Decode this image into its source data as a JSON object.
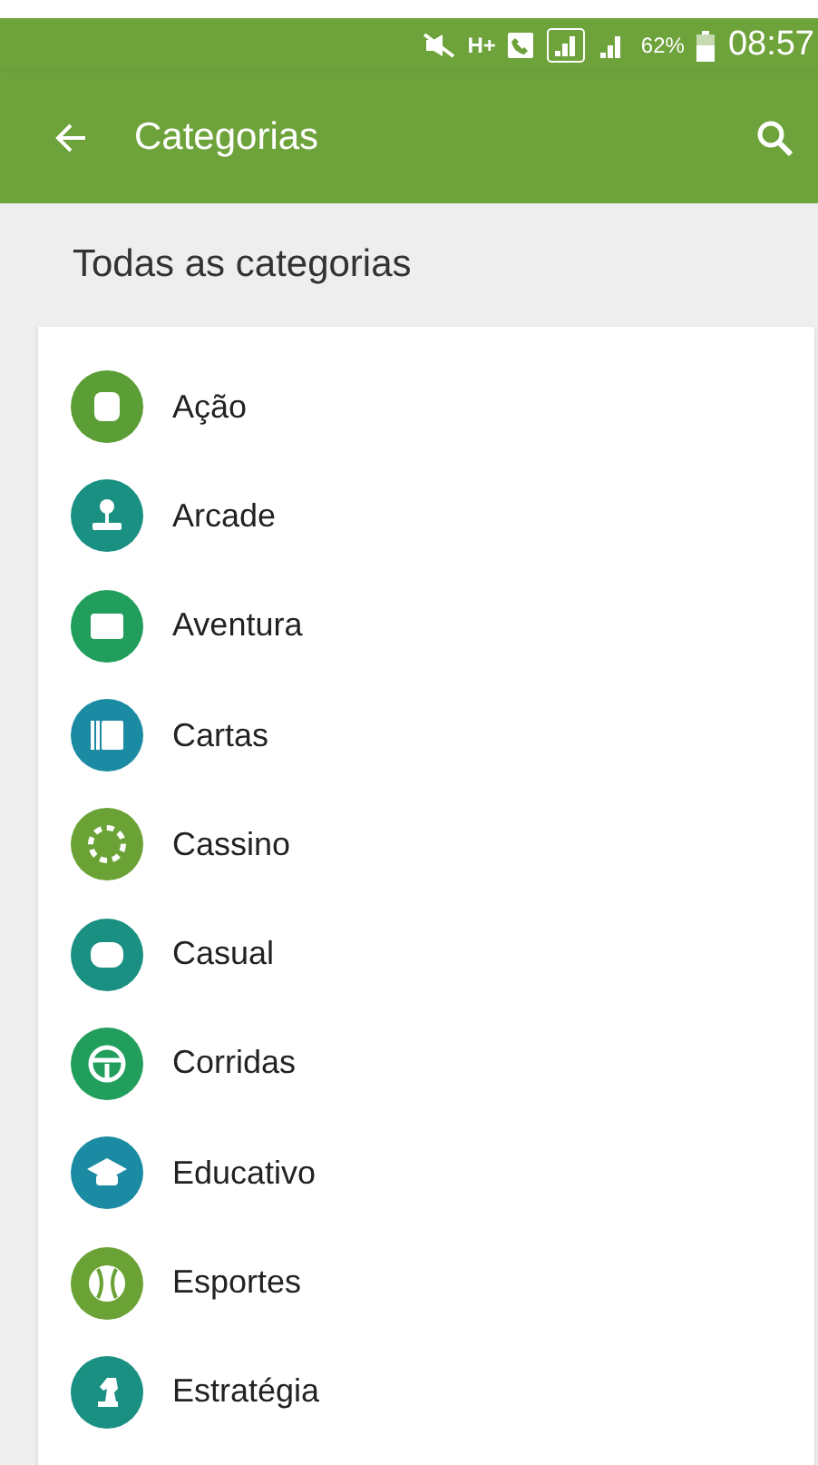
{
  "status_bar": {
    "network": "H+",
    "battery": "62%",
    "time": "08:57"
  },
  "app_bar": {
    "title": "Categorias"
  },
  "section_title": "Todas as categorias",
  "categories": [
    {
      "label": "Ação",
      "color": "#5b9e35",
      "kind": "fist"
    },
    {
      "label": "Arcade",
      "color": "#1a9082",
      "kind": "joystick"
    },
    {
      "label": "Aventura",
      "color": "#229e5c",
      "kind": "map"
    },
    {
      "label": "Cartas",
      "color": "#1b8ba3",
      "kind": "cards"
    },
    {
      "label": "Cassino",
      "color": "#6aa236",
      "kind": "chip"
    },
    {
      "label": "Casual",
      "color": "#1a9082",
      "kind": "face"
    },
    {
      "label": "Corridas",
      "color": "#229e5c",
      "kind": "wheel"
    },
    {
      "label": "Educativo",
      "color": "#1b8ba3",
      "kind": "cap"
    },
    {
      "label": "Esportes",
      "color": "#6aa236",
      "kind": "ball"
    },
    {
      "label": "Estratégia",
      "color": "#1a9082",
      "kind": "knight"
    }
  ]
}
